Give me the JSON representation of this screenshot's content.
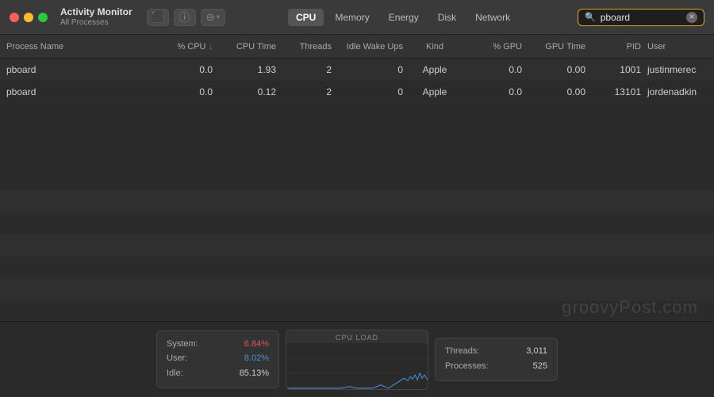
{
  "app": {
    "title": "Activity Monitor",
    "subtitle": "All Processes"
  },
  "toolbar": {
    "stop_label": "⬛",
    "info_label": "ⓘ",
    "filter_label": "⊖",
    "filter_arrow": "▾"
  },
  "nav_tabs": [
    {
      "label": "CPU",
      "active": true
    },
    {
      "label": "Memory",
      "active": false
    },
    {
      "label": "Energy",
      "active": false
    },
    {
      "label": "Disk",
      "active": false
    },
    {
      "label": "Network",
      "active": false
    }
  ],
  "search": {
    "placeholder": "Search",
    "value": "pboard"
  },
  "table": {
    "columns": [
      {
        "label": "Process Name",
        "key": "process"
      },
      {
        "label": "% CPU",
        "key": "cpu",
        "sorted": true
      },
      {
        "label": "CPU Time",
        "key": "cputime"
      },
      {
        "label": "Threads",
        "key": "threads"
      },
      {
        "label": "Idle Wake Ups",
        "key": "idle"
      },
      {
        "label": "Kind",
        "key": "kind"
      },
      {
        "label": "% GPU",
        "key": "gpu"
      },
      {
        "label": "GPU Time",
        "key": "gputime"
      },
      {
        "label": "PID",
        "key": "pid"
      },
      {
        "label": "User",
        "key": "user"
      }
    ],
    "rows": [
      {
        "process": "pboard",
        "cpu": "0.0",
        "cputime": "1.93",
        "threads": "2",
        "idle": "0",
        "kind": "Apple",
        "gpu": "0.0",
        "gputime": "0.00",
        "pid": "1001",
        "user": "justinmerec"
      },
      {
        "process": "pboard",
        "cpu": "0.0",
        "cputime": "0.12",
        "threads": "2",
        "idle": "0",
        "kind": "Apple",
        "gpu": "0.0",
        "gputime": "0.00",
        "pid": "13101",
        "user": "jordenadkin"
      }
    ]
  },
  "watermark": "groovyPost.com",
  "bottom": {
    "cpu_load_label": "CPU LOAD",
    "stats_left": [
      {
        "label": "System:",
        "value": "6.84%",
        "color": "red"
      },
      {
        "label": "User:",
        "value": "8.02%",
        "color": "blue"
      },
      {
        "label": "Idle:",
        "value": "85.13%",
        "color": "light"
      }
    ],
    "stats_right": [
      {
        "label": "Threads:",
        "value": "3,011"
      },
      {
        "label": "Processes:",
        "value": "525"
      }
    ]
  }
}
